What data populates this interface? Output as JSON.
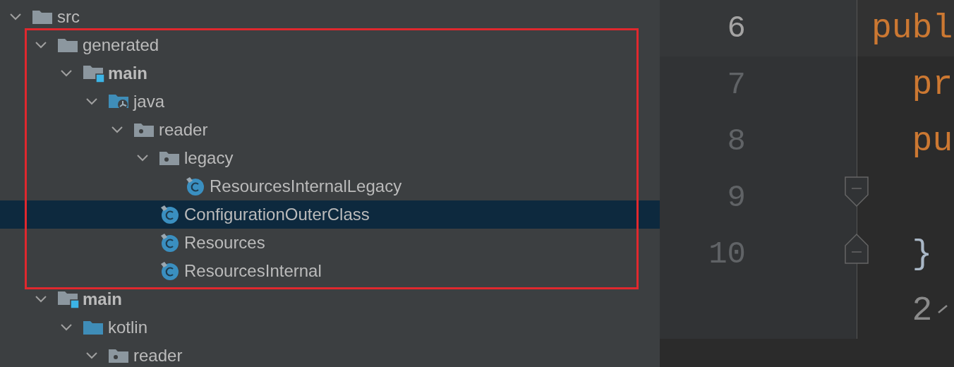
{
  "tree": [
    {
      "label": "src",
      "kind": "folder",
      "bold": false,
      "expanded": true,
      "selected": false,
      "children": [
        {
          "label": "generated",
          "kind": "folder",
          "bold": false,
          "expanded": true,
          "selected": false,
          "children": [
            {
              "label": "main",
              "kind": "module",
              "bold": true,
              "expanded": true,
              "selected": false,
              "children": [
                {
                  "label": "java",
                  "kind": "sourceroot",
                  "bold": false,
                  "expanded": true,
                  "selected": false,
                  "children": [
                    {
                      "label": "reader",
                      "kind": "package",
                      "bold": false,
                      "expanded": true,
                      "selected": false,
                      "children": [
                        {
                          "label": "legacy",
                          "kind": "package",
                          "bold": false,
                          "expanded": true,
                          "selected": false,
                          "children": [
                            {
                              "label": "ResourcesInternalLegacy",
                              "kind": "class",
                              "bold": false,
                              "selected": false
                            }
                          ]
                        },
                        {
                          "label": "ConfigurationOuterClass",
                          "kind": "class",
                          "bold": false,
                          "selected": true
                        },
                        {
                          "label": "Resources",
                          "kind": "class",
                          "bold": false,
                          "selected": false
                        },
                        {
                          "label": "ResourcesInternal",
                          "kind": "class",
                          "bold": false,
                          "selected": false
                        }
                      ]
                    }
                  ]
                }
              ]
            }
          ]
        },
        {
          "label": "main",
          "kind": "module",
          "bold": true,
          "expanded": true,
          "selected": false,
          "children": [
            {
              "label": "kotlin",
              "kind": "sourcefolder",
              "bold": false,
              "expanded": true,
              "selected": false,
              "children": [
                {
                  "label": "reader",
                  "kind": "package",
                  "bold": false,
                  "expanded": true,
                  "selected": false
                }
              ]
            }
          ]
        }
      ]
    }
  ],
  "editor": {
    "lines": [
      {
        "kind": "line",
        "number": "6",
        "current": true,
        "code": "publ"
      },
      {
        "kind": "line",
        "number": "7",
        "current": false,
        "code": "  pr"
      },
      {
        "kind": "line",
        "number": "8",
        "current": false,
        "code": "  pu"
      },
      {
        "kind": "foldstart",
        "number": "9",
        "current": false
      },
      {
        "kind": "foldend",
        "number": "10",
        "current": false,
        "code": "  }"
      },
      {
        "kind": "hint",
        "code": "  2"
      }
    ]
  }
}
